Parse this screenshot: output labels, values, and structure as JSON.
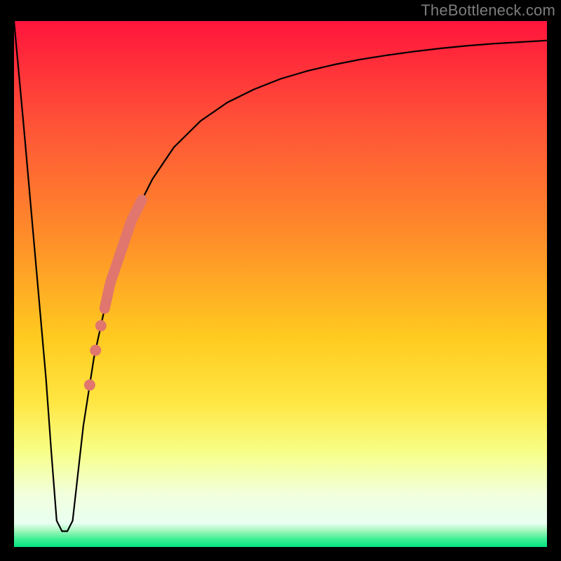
{
  "watermark": "TheBottleneck.com",
  "colors": {
    "black": "#000000",
    "curve": "#000000",
    "marker": "#e0766d",
    "gradient_stops": [
      {
        "offset": 0.0,
        "color": "#ff153c"
      },
      {
        "offset": 0.2,
        "color": "#ff5437"
      },
      {
        "offset": 0.4,
        "color": "#ff8a2a"
      },
      {
        "offset": 0.6,
        "color": "#ffca20"
      },
      {
        "offset": 0.72,
        "color": "#ffe540"
      },
      {
        "offset": 0.82,
        "color": "#f7ff88"
      },
      {
        "offset": 0.9,
        "color": "#f1ffdd"
      },
      {
        "offset": 0.955,
        "color": "#e9fff1"
      },
      {
        "offset": 0.97,
        "color": "#9cf6ba"
      },
      {
        "offset": 0.985,
        "color": "#3eef93"
      },
      {
        "offset": 1.0,
        "color": "#04e481"
      }
    ]
  },
  "chart_data": {
    "type": "line",
    "title": "",
    "xlabel": "",
    "ylabel": "",
    "xlim": [
      0,
      100
    ],
    "ylim": [
      0,
      100
    ],
    "series": [
      {
        "name": "bottleneck-curve",
        "x": [
          0,
          2,
          4,
          6,
          7,
          8,
          9,
          10,
          11,
          12,
          13,
          15,
          18,
          22,
          26,
          30,
          35,
          40,
          45,
          50,
          55,
          60,
          65,
          70,
          75,
          80,
          85,
          90,
          95,
          100
        ],
        "y": [
          100,
          78,
          55,
          32,
          18,
          5,
          3,
          3,
          5,
          14,
          23,
          36,
          50,
          62,
          70,
          76,
          81,
          84.5,
          87,
          89,
          90.5,
          91.7,
          92.7,
          93.5,
          94.2,
          94.8,
          95.3,
          95.7,
          96.0,
          96.3
        ]
      }
    ],
    "highlight_segment": {
      "description": "thick salmon segment along curve",
      "x_start": 17,
      "x_end": 24,
      "thickness": 15
    },
    "highlight_dots": {
      "description": "salmon dots along curve below segment",
      "points": [
        {
          "x": 16.3,
          "y_on_curve": true
        },
        {
          "x": 15.3,
          "y_on_curve": true
        },
        {
          "x": 14.2,
          "y_on_curve": true
        }
      ],
      "radius": 8
    }
  }
}
